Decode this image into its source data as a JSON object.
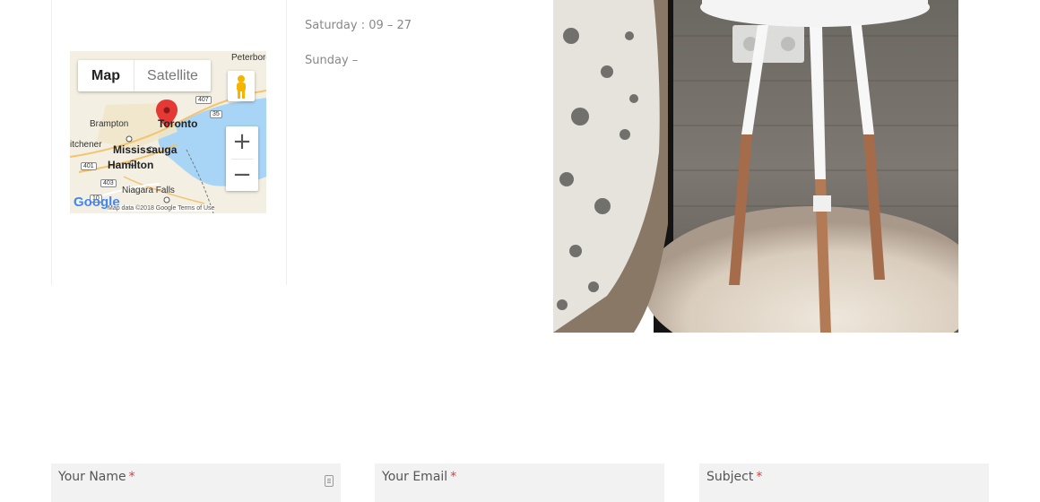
{
  "hours": {
    "saturday": "Saturday : 09 – 27",
    "sunday": "Sunday  –"
  },
  "map": {
    "type_map": "Map",
    "type_satellite": "Satellite",
    "zoom_in": "+",
    "zoom_out": "−",
    "labels": {
      "peterborough": "Peterboro",
      "brampton": "Brampton",
      "toronto": "Toronto",
      "kitchener": "itchener",
      "mississauga": "Mississauga",
      "hamilton": "Hamilton",
      "niagara": "Niagara Falls",
      "r401": "401",
      "r403": "403",
      "r407": "407",
      "r35": "35",
      "r10": "10"
    },
    "logo": "Google",
    "attribution": "Map data ©2018 Google  Terms of Use"
  },
  "form": {
    "name_label": "Your Name",
    "email_label": "Your Email",
    "subject_label": "Subject",
    "required_mark": "*"
  },
  "colors": {
    "accent_required": "#e53935",
    "field_bg": "#f2f2f2",
    "water": "#a8d4f5",
    "pin": "#e53935"
  }
}
